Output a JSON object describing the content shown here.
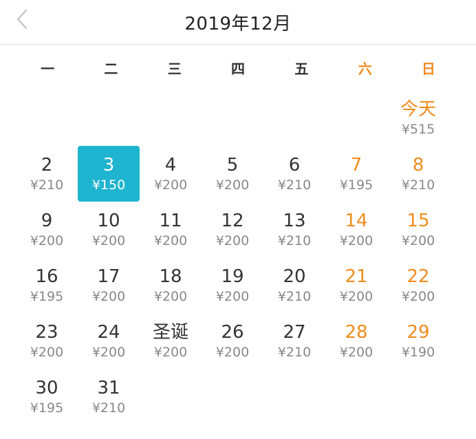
{
  "header": {
    "title": "2019年12月"
  },
  "weekdays": [
    {
      "label": "一",
      "weekend": false
    },
    {
      "label": "二",
      "weekend": false
    },
    {
      "label": "三",
      "weekend": false
    },
    {
      "label": "四",
      "weekend": false
    },
    {
      "label": "五",
      "weekend": false
    },
    {
      "label": "六",
      "weekend": true
    },
    {
      "label": "日",
      "weekend": true
    }
  ],
  "colors": {
    "accent": "#1fb4cf",
    "weekend": "#f08c1e"
  },
  "cells": [
    {
      "blank": true
    },
    {
      "blank": true
    },
    {
      "blank": true
    },
    {
      "blank": true
    },
    {
      "blank": true
    },
    {
      "blank": true
    },
    {
      "day": "今天",
      "price": "¥515",
      "weekend": true,
      "today": true
    },
    {
      "day": "2",
      "price": "¥210"
    },
    {
      "day": "3",
      "price": "¥150",
      "selected": true
    },
    {
      "day": "4",
      "price": "¥200"
    },
    {
      "day": "5",
      "price": "¥200"
    },
    {
      "day": "6",
      "price": "¥210"
    },
    {
      "day": "7",
      "price": "¥195",
      "weekend": true
    },
    {
      "day": "8",
      "price": "¥210",
      "weekend": true
    },
    {
      "day": "9",
      "price": "¥200"
    },
    {
      "day": "10",
      "price": "¥200"
    },
    {
      "day": "11",
      "price": "¥200"
    },
    {
      "day": "12",
      "price": "¥200"
    },
    {
      "day": "13",
      "price": "¥210"
    },
    {
      "day": "14",
      "price": "¥200",
      "weekend": true
    },
    {
      "day": "15",
      "price": "¥200",
      "weekend": true
    },
    {
      "day": "16",
      "price": "¥195"
    },
    {
      "day": "17",
      "price": "¥200"
    },
    {
      "day": "18",
      "price": "¥200"
    },
    {
      "day": "19",
      "price": "¥200"
    },
    {
      "day": "20",
      "price": "¥210"
    },
    {
      "day": "21",
      "price": "¥200",
      "weekend": true
    },
    {
      "day": "22",
      "price": "¥200",
      "weekend": true
    },
    {
      "day": "23",
      "price": "¥200"
    },
    {
      "day": "24",
      "price": "¥200"
    },
    {
      "day": "圣诞",
      "price": "¥200",
      "holiday": true
    },
    {
      "day": "26",
      "price": "¥200"
    },
    {
      "day": "27",
      "price": "¥210"
    },
    {
      "day": "28",
      "price": "¥200",
      "weekend": true
    },
    {
      "day": "29",
      "price": "¥190",
      "weekend": true
    },
    {
      "day": "30",
      "price": "¥195"
    },
    {
      "day": "31",
      "price": "¥210"
    }
  ]
}
